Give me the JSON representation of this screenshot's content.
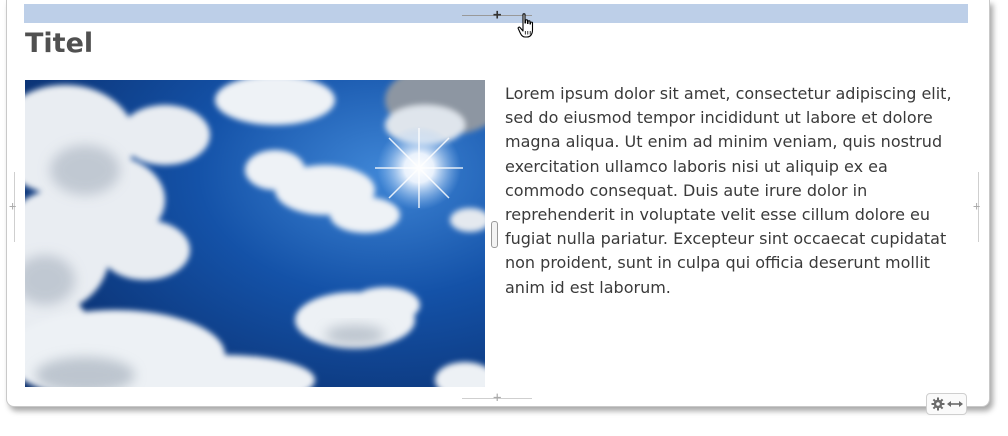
{
  "content": {
    "title": "Titel",
    "body": "Lorem ipsum dolor sit amet, consectetur adipiscing elit, sed do eiusmod tempor incididunt ut labore et dolore magna aliqua. Ut enim ad minim veniam, quis nostrud exercitation ullamco laboris nisi ut aliquip ex ea commodo consequat. Duis aute irure dolor in reprehenderit in voluptate velit esse cillum dolore eu fugiat nulla pariatur. Excepteur sint occaecat cupidatat non proident, sunt in culpa qui officia deserunt mollit anim id est laborum."
  },
  "image": {
    "subject": "blue sky with white clouds and sun"
  },
  "icons": {
    "add_handle": "plus-icon",
    "settings": "gear-icon",
    "resize": "horizontal-arrows-icon",
    "pointer": "hand-cursor-icon"
  },
  "colors": {
    "drop_zone": "#bdcfe8",
    "title": "#505050",
    "text": "#3a3a3a",
    "sky": "#0d3f8c"
  }
}
